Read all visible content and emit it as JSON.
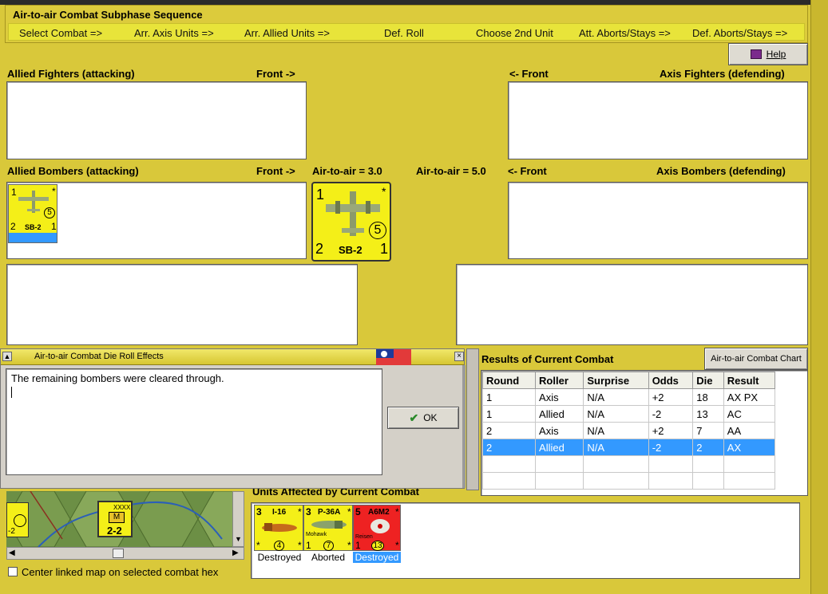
{
  "window": {
    "title": "Air-to-air Combat"
  },
  "sequence": {
    "title": "Air-to-air Combat Subphase Sequence",
    "steps": [
      "Select Combat =>",
      "Arr. Axis Units =>",
      "Arr. Allied Units =>",
      "Def. Roll",
      "Choose 2nd Unit",
      "Att. Aborts/Stays =>",
      "Def. Aborts/Stays =>"
    ]
  },
  "help_button": {
    "label": "Help"
  },
  "allied_fighters": {
    "label": "Allied Fighters (attacking)",
    "front": "Front ->"
  },
  "axis_fighters": {
    "label": "Axis Fighters (defending)",
    "front": "<- Front"
  },
  "allied_bombers": {
    "label": "Allied Bombers (attacking)",
    "front": "Front ->",
    "air_to_air": "Air-to-air = 3.0"
  },
  "axis_bombers": {
    "label": "Axis Bombers (defending)",
    "front": "<- Front",
    "air_to_air": "Air-to-air = 5.0"
  },
  "bomber_unit": {
    "name": "SB-2",
    "top_left": "1",
    "top_right": "*",
    "circle": "5",
    "bottom_left": "2",
    "bottom_right": "1"
  },
  "dialog": {
    "title": "Air-to-air Combat Die Roll Effects",
    "message": "The remaining bombers were cleared through.",
    "ok_label": "OK"
  },
  "results": {
    "title": "Results of Current Combat",
    "chart_button": "Air-to-air Combat Chart",
    "columns": [
      "Round",
      "Roller",
      "Surprise",
      "Odds",
      "Die",
      "Result"
    ],
    "rows": [
      [
        "1",
        "Axis",
        "N/A",
        "+2",
        "18",
        "AX PX"
      ],
      [
        "1",
        "Allied",
        "N/A",
        "-2",
        "13",
        "AC"
      ],
      [
        "2",
        "Axis",
        "N/A",
        "+2",
        "7",
        "AA"
      ],
      [
        "2",
        "Allied",
        "N/A",
        "-2",
        "2",
        "AX"
      ]
    ],
    "selected_row": 3
  },
  "units_affected": {
    "title": "Units Affected by Current Combat",
    "units": [
      {
        "name": "I-16",
        "top_left": "3",
        "top_right": "*",
        "sub": "",
        "circle": "4",
        "bottom_left": "*",
        "bottom_right": "*",
        "status": "Destroyed",
        "color": "#f4ef18"
      },
      {
        "name": "P-36A",
        "top_left": "3",
        "top_right": "*",
        "sub": "Mohawk",
        "circle": "7",
        "bottom_left": "1",
        "bottom_right": "*",
        "status": "Aborted",
        "color": "#f4ef18"
      },
      {
        "name": "A6M2",
        "top_left": "5",
        "top_right": "*",
        "sub": "Reisen",
        "circle": "13",
        "bottom_left": "1",
        "bottom_right": "*",
        "status": "Destroyed",
        "color": "#ee2222"
      }
    ]
  },
  "map": {
    "counter_label": "XXXX",
    "counter_value": "2-2",
    "counter_letter": "M",
    "partial_counter": "-2",
    "center_checkbox": "Center linked map on selected combat hex"
  },
  "colors": {
    "background": "#d9c83a",
    "selection": "#3399ff",
    "counter_yellow": "#f4ef18",
    "axis_red": "#ee2222"
  }
}
